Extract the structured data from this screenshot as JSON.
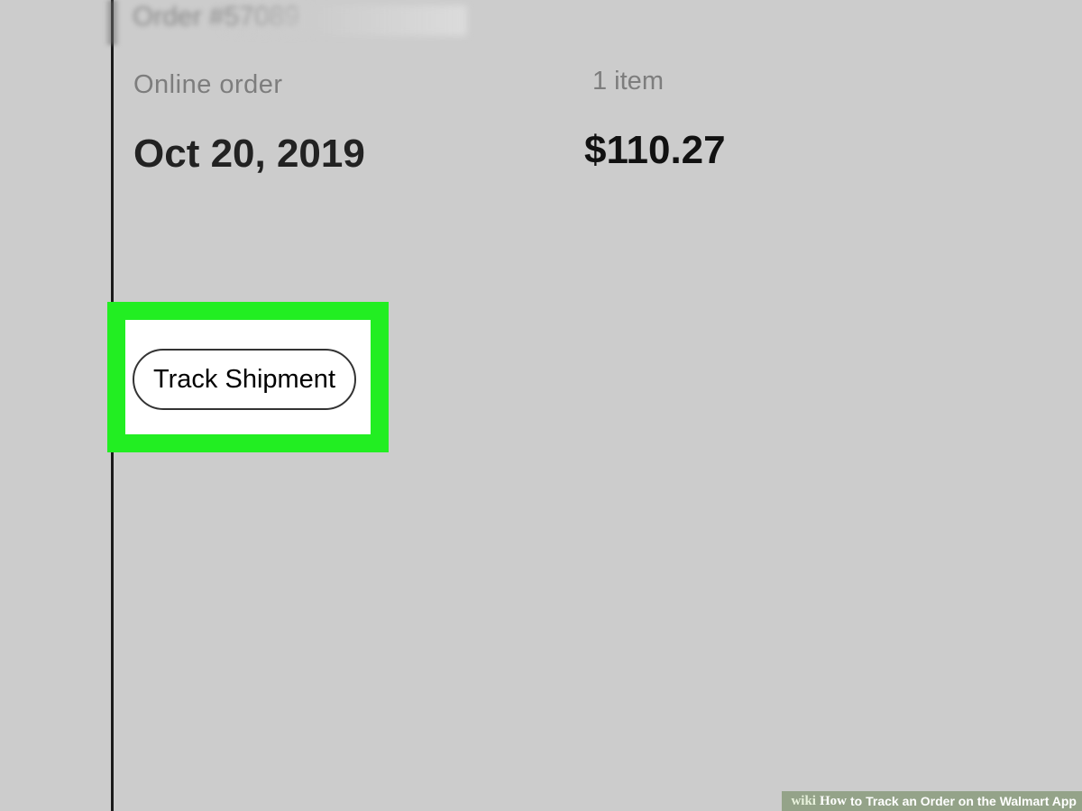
{
  "order": {
    "number_label": "Order #57089",
    "type": "Online order",
    "item_count": "1 item",
    "date": "Oct 20, 2019",
    "total": "$110.27"
  },
  "actions": {
    "track_label": "Track Shipment"
  },
  "colors": {
    "background": "#cccccc",
    "highlight": "#22ee22"
  },
  "watermark": {
    "wiki": "wiki",
    "how": "How",
    "title": "to Track an Order on the Walmart App"
  }
}
